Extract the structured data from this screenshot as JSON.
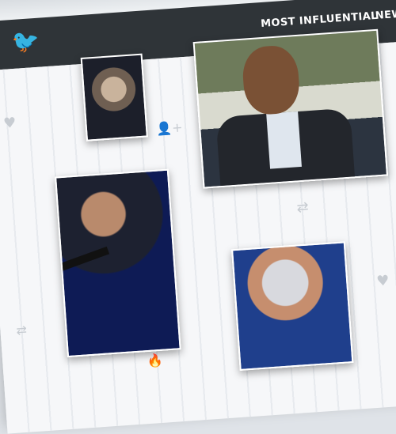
{
  "brand": {
    "logo_icon": "twitter-bird-icon"
  },
  "nav": {
    "items": [
      "MOST INFLUENTIAL",
      "NEW"
    ]
  },
  "icons": [
    "heart-icon",
    "user-add-icon",
    "retweet-icon",
    "heart-icon",
    "retweet-icon",
    "fire-icon"
  ],
  "colors": {
    "nav_bg": "#2f3438",
    "twitter_blue": "#1da1f2",
    "icon_gray": "#c7ccd2",
    "content_bg": "#f6f7f9"
  }
}
